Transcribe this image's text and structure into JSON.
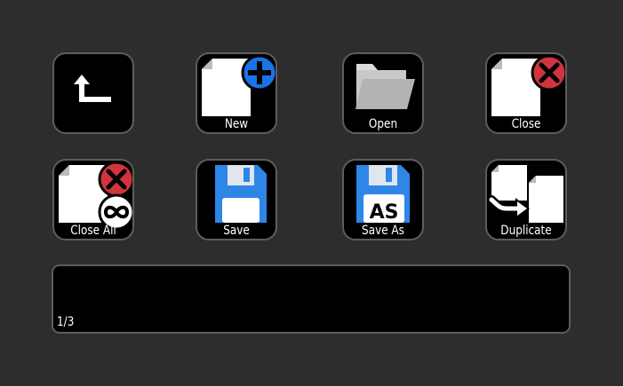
{
  "keys": {
    "back": {
      "label": "",
      "icon": "back-arrow-icon"
    },
    "new": {
      "label": "New",
      "icon": "new-file-icon"
    },
    "open": {
      "label": "Open",
      "icon": "folder-icon"
    },
    "close": {
      "label": "Close",
      "icon": "close-file-icon"
    },
    "close_all": {
      "label": "Close All",
      "icon": "close-all-files-icon"
    },
    "save": {
      "label": "Save",
      "icon": "floppy-disk-icon"
    },
    "save_as": {
      "label": "Save As",
      "icon": "floppy-disk-as-icon",
      "badge": "AS"
    },
    "duplicate": {
      "label": "Duplicate",
      "icon": "duplicate-file-icon"
    }
  },
  "touchstrip": {
    "page_indicator": "1/3"
  },
  "colors": {
    "background": "#2d2d2d",
    "key_fill": "#000000",
    "key_border": "#5d5d5d",
    "accent_blue": "#1a73e8",
    "close_red": "#d0343c",
    "floppy_blue": "#2e86e6",
    "folder_gray": "#b3b3b3"
  }
}
